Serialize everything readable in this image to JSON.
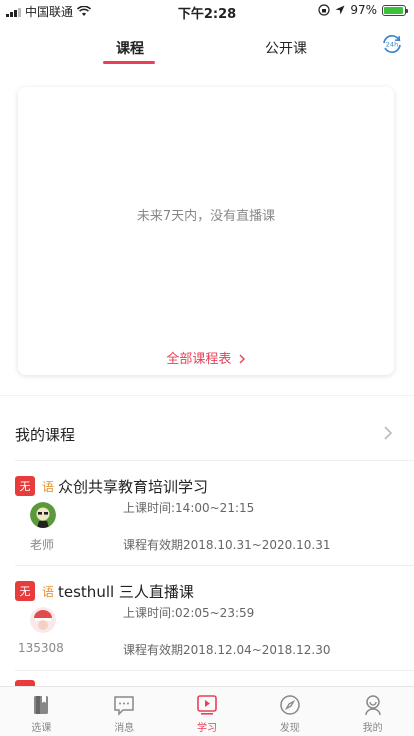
{
  "status": {
    "carrier": "中国联通",
    "time": "下午2:28",
    "battery": "97%",
    "battery_level": 0.97,
    "battery_color": "#3cc13b"
  },
  "top_tabs": [
    {
      "label": "课程",
      "active": true
    },
    {
      "label": "公开课",
      "active": false
    }
  ],
  "accent_color": "#e94057",
  "live_card": {
    "empty_text": "未来7天内，没有直播课",
    "link_label": "全部课程表"
  },
  "my_courses": {
    "title": "我的课程",
    "items": [
      {
        "badge": "无",
        "lang": "语",
        "title": "众创共享教育培训学习",
        "teacher": "老师",
        "time": "上课时间:14:00~21:15",
        "valid": "课程有效期2018.10.31~2020.10.31"
      },
      {
        "badge": "无",
        "lang": "语",
        "title": "testhull 三人直播课",
        "teacher": "135308",
        "time": "上课时间:02:05~23:59",
        "valid": "课程有效期2018.12.04~2018.12.30"
      }
    ]
  },
  "tabbar": [
    {
      "label": "选课",
      "icon": "book-icon",
      "active": false
    },
    {
      "label": "消息",
      "icon": "message-icon",
      "active": false
    },
    {
      "label": "学习",
      "icon": "play-video-icon",
      "active": true
    },
    {
      "label": "发现",
      "icon": "compass-icon",
      "active": false
    },
    {
      "label": "我的",
      "icon": "user-icon",
      "active": false
    }
  ]
}
